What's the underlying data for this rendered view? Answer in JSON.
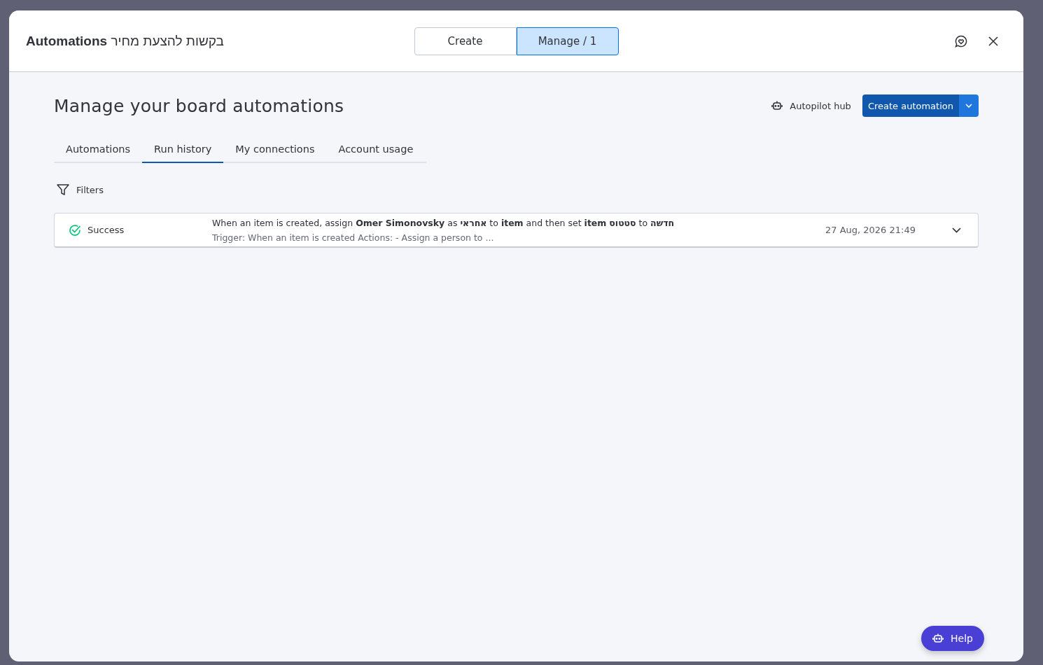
{
  "modal": {
    "title": "**Automations** בקשות להצעת מחיר",
    "segments": [
      {
        "label": "Create",
        "selected": false
      },
      {
        "label": "Manage / 1",
        "selected": true
      }
    ]
  },
  "page": {
    "heading": "Manage your board automations",
    "hub_link": "Autopilot hub",
    "create_button": "Create automation",
    "tabs": [
      {
        "label": "Automations",
        "selected": false
      },
      {
        "label": "Run history",
        "selected": true
      },
      {
        "label": "My connections",
        "selected": false
      },
      {
        "label": "Account usage",
        "selected": false
      }
    ],
    "filters": "Filters",
    "runs": [
      {
        "status": "Success",
        "kind": "success",
        "description": "When an item is created, assign **Omer Simonovsky** as **אחראי** to **item** and then set **item** **סטטוס** to **חדשה**",
        "details": "Trigger: When an item is created Actions: - Assign a person to ...",
        "time": "27 Aug, 2026 21:49",
        "expanded": false
      }
    ]
  },
  "help_button": "Help"
}
